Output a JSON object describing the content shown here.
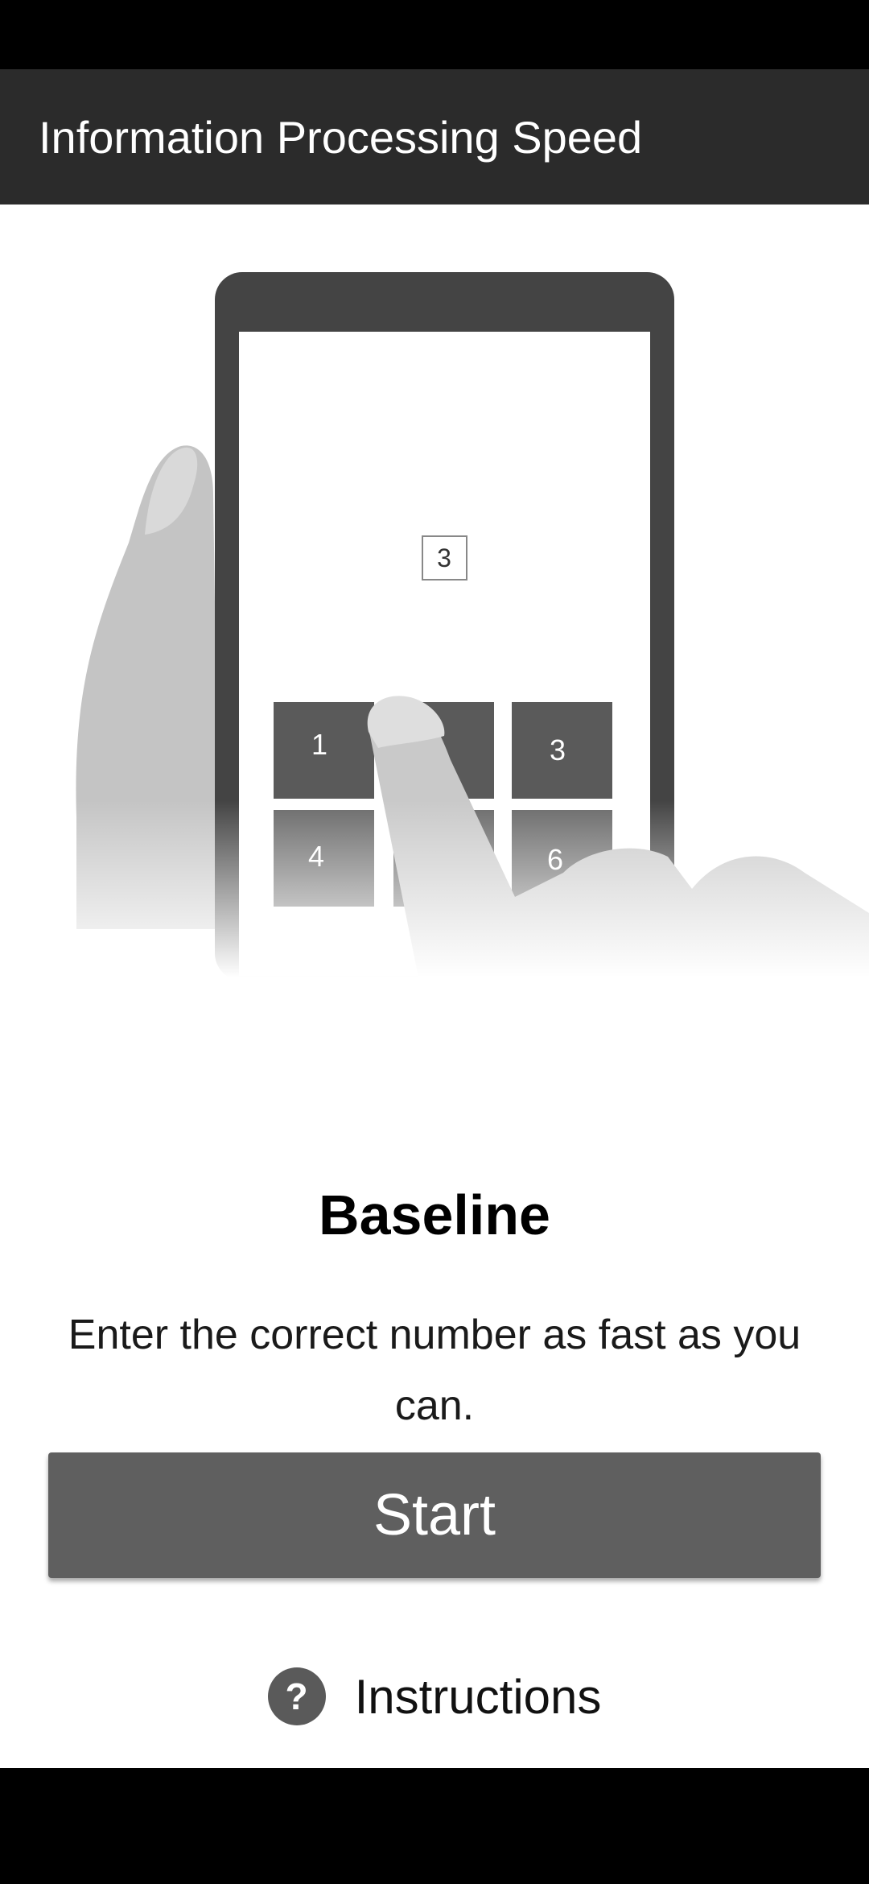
{
  "app_bar": {
    "title": "Information Processing Speed"
  },
  "illustration": {
    "target_digit": "3",
    "keypad_digits": [
      "1",
      "",
      "3",
      "4",
      "",
      "6"
    ]
  },
  "main": {
    "heading": "Baseline",
    "description": "Enter the correct number as fast as you can.",
    "start_label": "Start",
    "instructions_icon": "?",
    "instructions_label": "Instructions"
  },
  "colors": {
    "app_bar": "#2b2b2b",
    "button": "#5f5f5f",
    "phone_frame": "#444444",
    "key": "#5a5a5a"
  }
}
